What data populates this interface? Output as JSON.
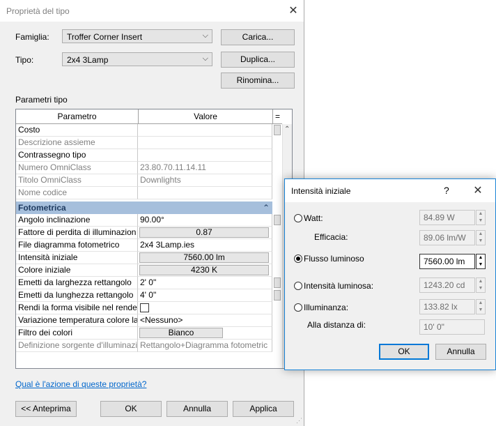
{
  "main_dialog": {
    "title": "Proprietà del tipo",
    "famiglia_label": "Famiglia:",
    "famiglia_value": "Troffer Corner Insert",
    "tipo_label": "Tipo:",
    "tipo_value": "2x4 3Lamp",
    "carica_label": "Carica...",
    "duplica_label": "Duplica...",
    "rinomina_label": "Rinomina...",
    "parametri_tipo_label": "Parametri tipo",
    "grid": {
      "col_param": "Parametro",
      "col_value": "Valore",
      "col_eq": "="
    },
    "rows_top": [
      {
        "param": "Costo",
        "value": "",
        "gray": false
      },
      {
        "param": "Descrizione assieme",
        "value": "",
        "gray": true
      },
      {
        "param": "Contrassegno tipo",
        "value": "",
        "gray": false
      },
      {
        "param": "Numero OmniClass",
        "value": "23.80.70.11.14.11",
        "gray": true
      },
      {
        "param": "Titolo OmniClass",
        "value": "Downlights",
        "gray": true
      },
      {
        "param": "Nome codice",
        "value": "",
        "gray": true
      }
    ],
    "section_fotometrica": "Fotometrica",
    "rows_photo": [
      {
        "param": "Angolo inclinazione",
        "value": "90.00°"
      },
      {
        "param": "Fattore di perdita di illuminazion",
        "value": "0.87"
      },
      {
        "param": "File diagramma fotometrico",
        "value": "2x4 3Lamp.ies"
      },
      {
        "param": "Intensità iniziale",
        "value": "7560.00 lm"
      },
      {
        "param": "Colore iniziale",
        "value": "4230 K"
      },
      {
        "param": "Emetti da larghezza rettangolo",
        "value": "2'  0\""
      },
      {
        "param": "Emetti da lunghezza rettangolo",
        "value": "4'  0\""
      },
      {
        "param": "Rendi la forma visibile nel render",
        "value": ""
      },
      {
        "param": "Variazione temperatura colore la",
        "value": "<Nessuno>"
      },
      {
        "param": "Filtro dei colori",
        "value": "Bianco"
      },
      {
        "param": "Definizione sorgente d'illuminazi",
        "value": "Rettangolo+Diagramma fotometric"
      }
    ],
    "help_link": "Qual è l'azione di queste proprietà?",
    "anteprima_label": "<< Anteprima",
    "ok_label": "OK",
    "annulla_label": "Annulla",
    "applica_label": "Applica"
  },
  "intensity_dialog": {
    "title": "Intensità iniziale",
    "help_glyph": "?",
    "watt_label": "Watt:",
    "watt_value": "84.89 W",
    "efficacia_label": "Efficacia:",
    "efficacia_value": "89.06 lm/W",
    "flusso_label": "Flusso luminoso",
    "flusso_value": "7560.00 lm",
    "intensita_label": "Intensità luminosa:",
    "intensita_value": "1243.20 cd",
    "illuminanza_label": "Illuminanza:",
    "illuminanza_value": "133.82 lx",
    "distanza_label": "Alla distanza di:",
    "distanza_value": "10'  0\"",
    "selected_option": "flusso",
    "ok_label": "OK",
    "annulla_label": "Annulla"
  },
  "colors": {
    "accent": "#0078d7",
    "section_header": "#a6bfdc",
    "link": "#0066cc"
  }
}
